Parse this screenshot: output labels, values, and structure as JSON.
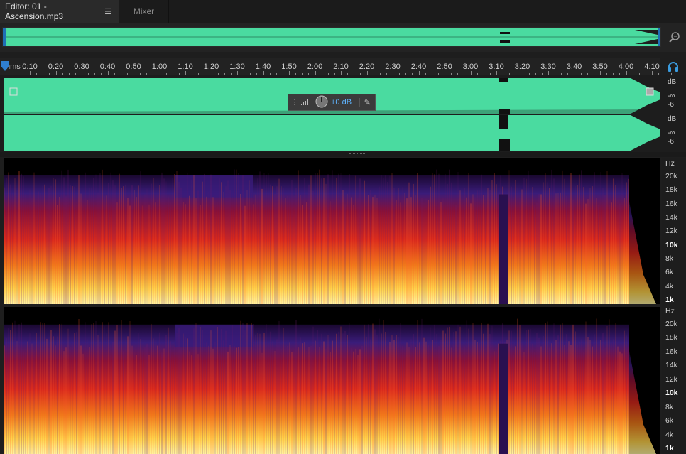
{
  "tabs": {
    "editor": "Editor: 01 - Ascension.mp3",
    "mixer": "Mixer"
  },
  "ruler": {
    "unit": "hms",
    "labels": [
      "0:10",
      "0:20",
      "0:30",
      "0:40",
      "0:50",
      "1:00",
      "1:10",
      "1:20",
      "1:30",
      "1:40",
      "1:50",
      "2:00",
      "2:10",
      "2:20",
      "2:30",
      "2:40",
      "2:50",
      "3:00",
      "3:10",
      "3:20",
      "3:30",
      "3:40",
      "3:50",
      "4:00",
      "4:10"
    ]
  },
  "hud": {
    "value": "+0 dB"
  },
  "db_scale": {
    "unit": "dB",
    "upper": "-∞",
    "lower": "-6"
  },
  "hz_scale": {
    "unit": "Hz",
    "labels": [
      "20k",
      "18k",
      "16k",
      "14k",
      "12k",
      "10k",
      "8k",
      "6k",
      "4k",
      "1k"
    ]
  },
  "colors": {
    "waveform": "#4adba0",
    "accent": "#1f6fb5",
    "spectral_low": "#ffe680",
    "spectral_mid": "#e0281e",
    "spectral_high": "#3a1c7a"
  },
  "icons": {
    "zoom": "zoom-icon",
    "headphones": "headphones-icon",
    "pin": "pin-icon",
    "menu": "panel-menu-icon"
  }
}
